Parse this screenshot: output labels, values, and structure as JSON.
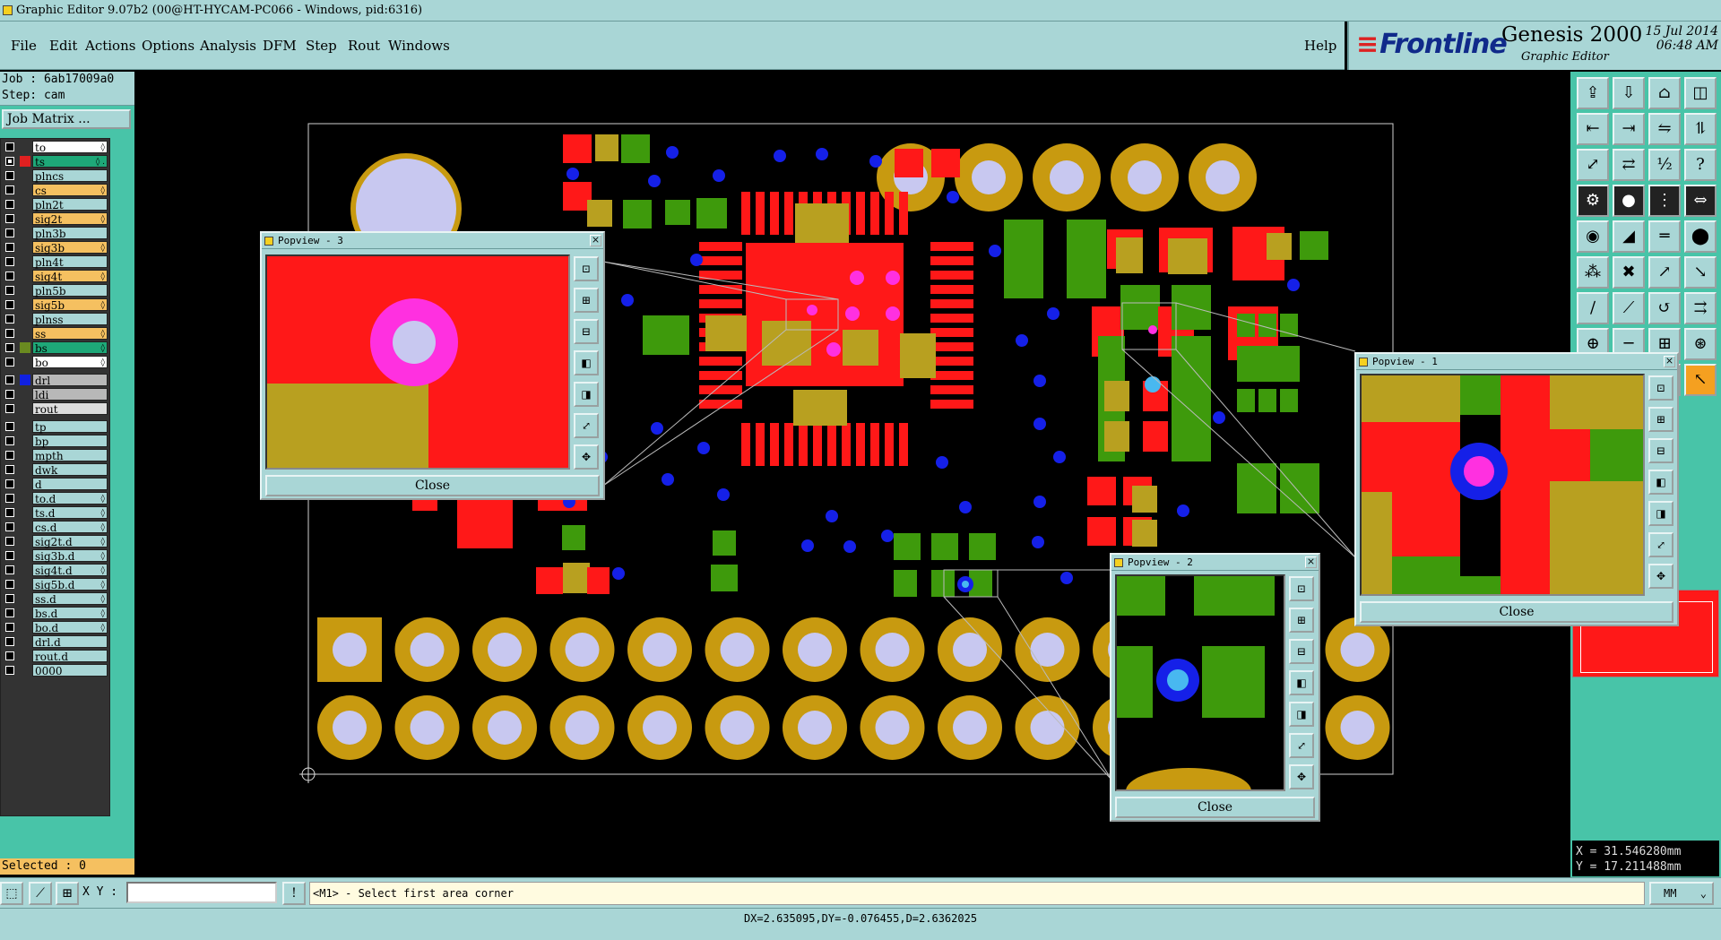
{
  "window": {
    "title": "Graphic Editor 9.07b2 (00@HT-HYCAM-PC066 - Windows, pid:6316)"
  },
  "menu": [
    "File",
    "Edit",
    "Actions",
    "Options",
    "Analysis",
    "DFM",
    "Step",
    "Rout",
    "Windows"
  ],
  "help_label": "Help",
  "brand": {
    "logo": "Frontline",
    "product": "Genesis 2000",
    "subtitle": "Graphic Editor",
    "date": "15 Jul 2014",
    "time": "06:48 AM"
  },
  "job": {
    "job_line": "Job : 6ab17009a0",
    "step_line": "Step: cam",
    "matrix_label": "Job Matrix ..."
  },
  "layers": [
    {
      "name": "to",
      "color": "#ffffff",
      "swatch": "",
      "checked": false,
      "mark": "◊"
    },
    {
      "name": "ts",
      "color": "#1ea878",
      "swatch": "#e02020",
      "checked": true,
      "mark": "◊ ."
    },
    {
      "name": "plncs",
      "color": "#a9d6d6",
      "swatch": "",
      "checked": false,
      "mark": ""
    },
    {
      "name": "cs",
      "color": "#f5c060",
      "swatch": "",
      "checked": false,
      "mark": "◊"
    },
    {
      "name": "pln2t",
      "color": "#a9d6d6",
      "swatch": "",
      "checked": false,
      "mark": ""
    },
    {
      "name": "sig2t",
      "color": "#f5c060",
      "swatch": "",
      "checked": false,
      "mark": "◊"
    },
    {
      "name": "pln3b",
      "color": "#a9d6d6",
      "swatch": "",
      "checked": false,
      "mark": ""
    },
    {
      "name": "sig3b",
      "color": "#f5c060",
      "swatch": "",
      "checked": false,
      "mark": "◊"
    },
    {
      "name": "pln4t",
      "color": "#a9d6d6",
      "swatch": "",
      "checked": false,
      "mark": ""
    },
    {
      "name": "sig4t",
      "color": "#f5c060",
      "swatch": "",
      "checked": false,
      "mark": "◊"
    },
    {
      "name": "pln5b",
      "color": "#a9d6d6",
      "swatch": "",
      "checked": false,
      "mark": ""
    },
    {
      "name": "sig5b",
      "color": "#f5c060",
      "swatch": "",
      "checked": false,
      "mark": "◊"
    },
    {
      "name": "plnss",
      "color": "#a9d6d6",
      "swatch": "",
      "checked": false,
      "mark": ""
    },
    {
      "name": "ss",
      "color": "#f5c060",
      "swatch": "",
      "checked": false,
      "mark": "◊"
    },
    {
      "name": "bs",
      "color": "#1ea878",
      "swatch": "#6a8a20",
      "checked": false,
      "mark": "◊"
    },
    {
      "name": "bo",
      "color": "#ffffff",
      "swatch": "",
      "checked": false,
      "mark": "◊"
    },
    {
      "name": "drl",
      "color": "#b8b8b8",
      "swatch": "#1020e0",
      "checked": false,
      "mark": ""
    },
    {
      "name": "ldi",
      "color": "#b8b8b8",
      "swatch": "",
      "checked": false,
      "mark": ""
    },
    {
      "name": "rout",
      "color": "#dddddd",
      "swatch": "",
      "checked": false,
      "mark": ""
    },
    {
      "name": "tp",
      "color": "#a9d6d6",
      "swatch": "",
      "checked": false,
      "mark": ""
    },
    {
      "name": "bp",
      "color": "#a9d6d6",
      "swatch": "",
      "checked": false,
      "mark": ""
    },
    {
      "name": "mpth",
      "color": "#a9d6d6",
      "swatch": "",
      "checked": false,
      "mark": ""
    },
    {
      "name": "dwk",
      "color": "#a9d6d6",
      "swatch": "",
      "checked": false,
      "mark": ""
    },
    {
      "name": "d",
      "color": "#a9d6d6",
      "swatch": "",
      "checked": false,
      "mark": ""
    },
    {
      "name": "to.d",
      "color": "#a9d6d6",
      "swatch": "",
      "checked": false,
      "mark": "◊"
    },
    {
      "name": "ts.d",
      "color": "#a9d6d6",
      "swatch": "",
      "checked": false,
      "mark": "◊"
    },
    {
      "name": "cs.d",
      "color": "#a9d6d6",
      "swatch": "",
      "checked": false,
      "mark": "◊"
    },
    {
      "name": "sig2t.d",
      "color": "#a9d6d6",
      "swatch": "",
      "checked": false,
      "mark": "◊"
    },
    {
      "name": "sig3b.d",
      "color": "#a9d6d6",
      "swatch": "",
      "checked": false,
      "mark": "◊"
    },
    {
      "name": "sig4t.d",
      "color": "#a9d6d6",
      "swatch": "",
      "checked": false,
      "mark": "◊"
    },
    {
      "name": "sig5b.d",
      "color": "#a9d6d6",
      "swatch": "",
      "checked": false,
      "mark": "◊"
    },
    {
      "name": "ss.d",
      "color": "#a9d6d6",
      "swatch": "",
      "checked": false,
      "mark": "◊"
    },
    {
      "name": "bs.d",
      "color": "#a9d6d6",
      "swatch": "",
      "checked": false,
      "mark": "◊"
    },
    {
      "name": "bo.d",
      "color": "#a9d6d6",
      "swatch": "",
      "checked": false,
      "mark": "◊"
    },
    {
      "name": "drl.d",
      "color": "#a9d6d6",
      "swatch": "",
      "checked": false,
      "mark": ""
    },
    {
      "name": "rout.d",
      "color": "#a9d6d6",
      "swatch": "",
      "checked": false,
      "mark": ""
    },
    {
      "name": "0000",
      "color": "#a9d6d6",
      "swatch": "",
      "checked": false,
      "mark": ""
    }
  ],
  "selected_label": "Selected : 0",
  "coords": {
    "x_line": "X = 31.546280mm",
    "y_line": "Y = 17.211488mm"
  },
  "status": {
    "xy_label": "X Y :",
    "xy_value": "",
    "prompt": "<M1> - Select first area corner",
    "units": "MM",
    "delta": "DX=2.635095,DY=-0.076455,D=2.6362025"
  },
  "popviews": [
    {
      "title": "Popview - 3",
      "close_label": "Close"
    },
    {
      "title": "Popview - 2",
      "close_label": "Close"
    },
    {
      "title": "Popview - 1",
      "close_label": "Close"
    }
  ],
  "colors": {
    "pad_red": "#ff1818",
    "pad_green": "#3e9a0c",
    "pad_gold": "#c89a10",
    "overlap": "#b8a020",
    "via_blue": "#1520e8",
    "via_magenta": "#ff30e0",
    "hole": "#c8c8f0",
    "panel": "#a9d6d6",
    "accent_teal": "#48c4a8"
  },
  "icons": [
    "home-icon",
    "save-icon",
    "open-icon",
    "close-icon",
    "zoom-fit-icon",
    "zoom-in-icon",
    "zoom-out-icon",
    "ruler-icon",
    "snap-icon",
    "measure-icon",
    "route-icon",
    "line-icon",
    "arc-icon",
    "pointer-icon",
    "help-icon"
  ]
}
